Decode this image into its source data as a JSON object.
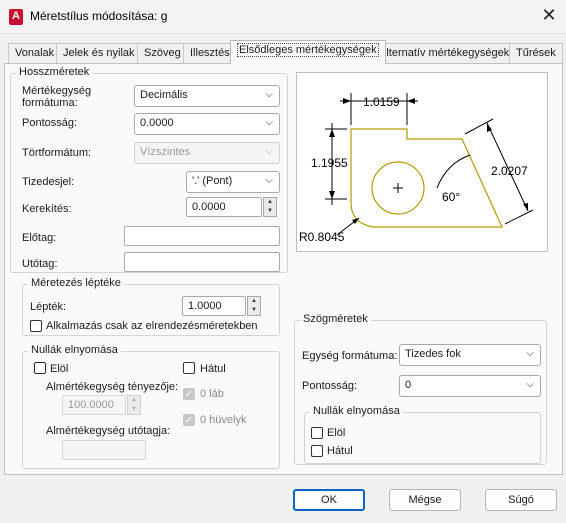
{
  "window": {
    "title": "Méretstílus módosítása: g",
    "close": "✕",
    "app_icon_letter": "A"
  },
  "tabs": [
    "Vonalak",
    "Jelek és nyilak",
    "Szöveg",
    "Illesztés",
    "Elsődleges mértékegységek",
    "Alternatív mértékegységek",
    "Tűrések"
  ],
  "linear": {
    "group_label": "Hosszméretek",
    "unit_format_label": "Mértékegység formátuma:",
    "unit_format_value": "Decimális",
    "precision_label": "Pontosság:",
    "precision_value": "0.0000",
    "fraction_format_label": "Törtformátum:",
    "fraction_format_value": "Vízszintes",
    "decimal_sep_label": "Tizedesjel:",
    "decimal_sep_value": "'.' (Pont)",
    "round_label": "Kerekítés:",
    "round_value": "0.0000",
    "prefix_label": "Előtag:",
    "prefix_value": "",
    "suffix_label": "Utótag:",
    "suffix_value": ""
  },
  "scale": {
    "group_label": "Méretezés léptéke",
    "factor_label": "Lépték:",
    "factor_value": "1.0000",
    "layout_only_label": "Alkalmazás csak az elrendezésméretekben"
  },
  "zero": {
    "group_label": "Nullák elnyomása",
    "leading_label": "Elöl",
    "trailing_label": "Hátul",
    "sub_factor_label": "Almértékegység tényezője:",
    "sub_factor_value": "100.0000",
    "feet_label": "0 láb",
    "inches_label": "0 hüvelyk",
    "sub_suffix_label": "Almértékegység utótagja:",
    "sub_suffix_value": ""
  },
  "angular": {
    "group_label": "Szögméretek",
    "format_label": "Egység formátuma:",
    "format_value": "Tizedes fok",
    "precision_label": "Pontosság:",
    "precision_value": "0",
    "zero_group_label": "Nullák elnyomása",
    "leading_label": "Elöl",
    "trailing_label": "Hátul"
  },
  "preview": {
    "dim_top": "1.0159",
    "dim_left": "1.1955",
    "dim_right": "2.0207",
    "dim_angle": "60°",
    "dim_radius": "R0.8045",
    "geometry_color": "#b49a00"
  },
  "buttons": {
    "ok": "OK",
    "cancel": "Mégse",
    "help": "Súgó"
  },
  "colors": {
    "accent": "#0a64c8",
    "app_icon": "#c8102e"
  }
}
